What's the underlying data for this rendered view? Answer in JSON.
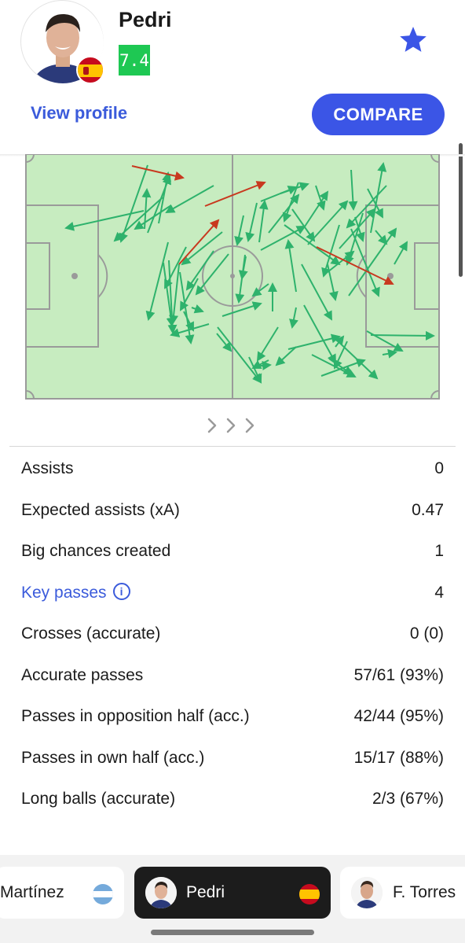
{
  "header": {
    "player_name": "Pedri",
    "rating": "7.4",
    "rating_color": "#1ec853",
    "view_profile_label": "View profile",
    "compare_label": "COMPARE",
    "favorite_icon": "star-icon",
    "nationality_flag": "spain-flag-icon",
    "accent_color": "#3b55e6"
  },
  "pass_map": {
    "pitch_color": "#c7ecc0",
    "line_color": "#9a9a9a",
    "accurate_color": "#2eb26c",
    "inaccurate_color": "#c8391f",
    "more_icon": "chevrons-right-icon"
  },
  "stats": [
    {
      "label": "Assists",
      "value": "0"
    },
    {
      "label": "Expected assists (xA)",
      "value": "0.47"
    },
    {
      "label": "Big chances created",
      "value": "1"
    },
    {
      "label": "Key passes",
      "value": "4"
    },
    {
      "label": "Crosses (accurate)",
      "value": "0 (0)"
    },
    {
      "label": "Accurate passes",
      "value": "57/61 (93%)"
    },
    {
      "label": "Passes in opposition half (acc.)",
      "value": "42/44 (95%)"
    },
    {
      "label": "Passes in own half (acc.)",
      "value": "15/17 (88%)"
    },
    {
      "label": "Long balls (accurate)",
      "value": "2/3 (67%)"
    }
  ],
  "player_switcher": [
    {
      "name": "Martínez",
      "flag": "argentina-flag-icon"
    },
    {
      "name": "Pedri",
      "flag": "spain-flag-icon",
      "selected": true
    },
    {
      "name": "F. Torres",
      "flag": "spain-flag-icon"
    }
  ]
}
